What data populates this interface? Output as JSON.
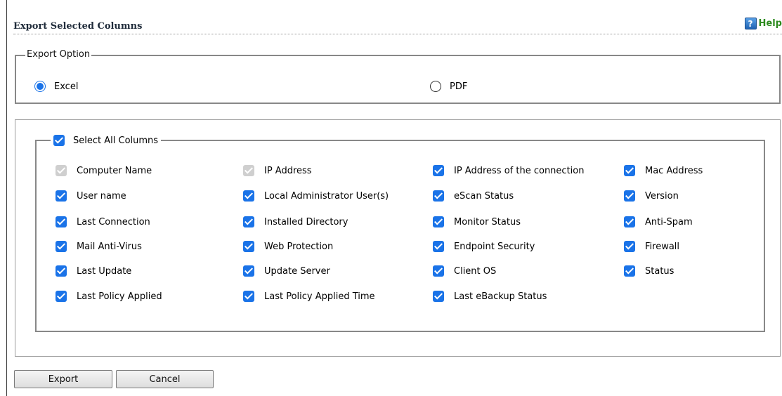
{
  "header": {
    "title": "Export Selected Columns",
    "help_label": "Help"
  },
  "export_option": {
    "legend": "Export Option",
    "options": [
      {
        "label": "Excel",
        "selected": true
      },
      {
        "label": "PDF",
        "selected": false
      }
    ]
  },
  "columns": {
    "select_all_label": "Select All Columns",
    "select_all_checked": true,
    "items": [
      {
        "label": "Computer Name",
        "checked": true,
        "disabled": true
      },
      {
        "label": "IP Address",
        "checked": true,
        "disabled": true
      },
      {
        "label": "IP Address of the connection",
        "checked": true,
        "disabled": false
      },
      {
        "label": "Mac Address",
        "checked": true,
        "disabled": false
      },
      {
        "label": "User name",
        "checked": true,
        "disabled": false
      },
      {
        "label": "Local Administrator User(s)",
        "checked": true,
        "disabled": false
      },
      {
        "label": "eScan Status",
        "checked": true,
        "disabled": false
      },
      {
        "label": "Version",
        "checked": true,
        "disabled": false
      },
      {
        "label": "Last Connection",
        "checked": true,
        "disabled": false
      },
      {
        "label": "Installed Directory",
        "checked": true,
        "disabled": false
      },
      {
        "label": "Monitor Status",
        "checked": true,
        "disabled": false
      },
      {
        "label": "Anti-Spam",
        "checked": true,
        "disabled": false
      },
      {
        "label": "Mail Anti-Virus",
        "checked": true,
        "disabled": false
      },
      {
        "label": "Web Protection",
        "checked": true,
        "disabled": false
      },
      {
        "label": "Endpoint Security",
        "checked": true,
        "disabled": false
      },
      {
        "label": "Firewall",
        "checked": true,
        "disabled": false
      },
      {
        "label": "Last Update",
        "checked": true,
        "disabled": false
      },
      {
        "label": "Update Server",
        "checked": true,
        "disabled": false
      },
      {
        "label": "Client OS",
        "checked": true,
        "disabled": false
      },
      {
        "label": "Status",
        "checked": true,
        "disabled": false
      },
      {
        "label": "Last Policy Applied",
        "checked": true,
        "disabled": false
      },
      {
        "label": "Last Policy Applied Time",
        "checked": true,
        "disabled": false
      },
      {
        "label": "Last eBackup Status",
        "checked": true,
        "disabled": false
      }
    ]
  },
  "buttons": {
    "export": "Export",
    "cancel": "Cancel"
  },
  "colors": {
    "accent": "#1a73e8",
    "help_green": "#2e8b1f",
    "disabled": "#cfcfcf"
  }
}
